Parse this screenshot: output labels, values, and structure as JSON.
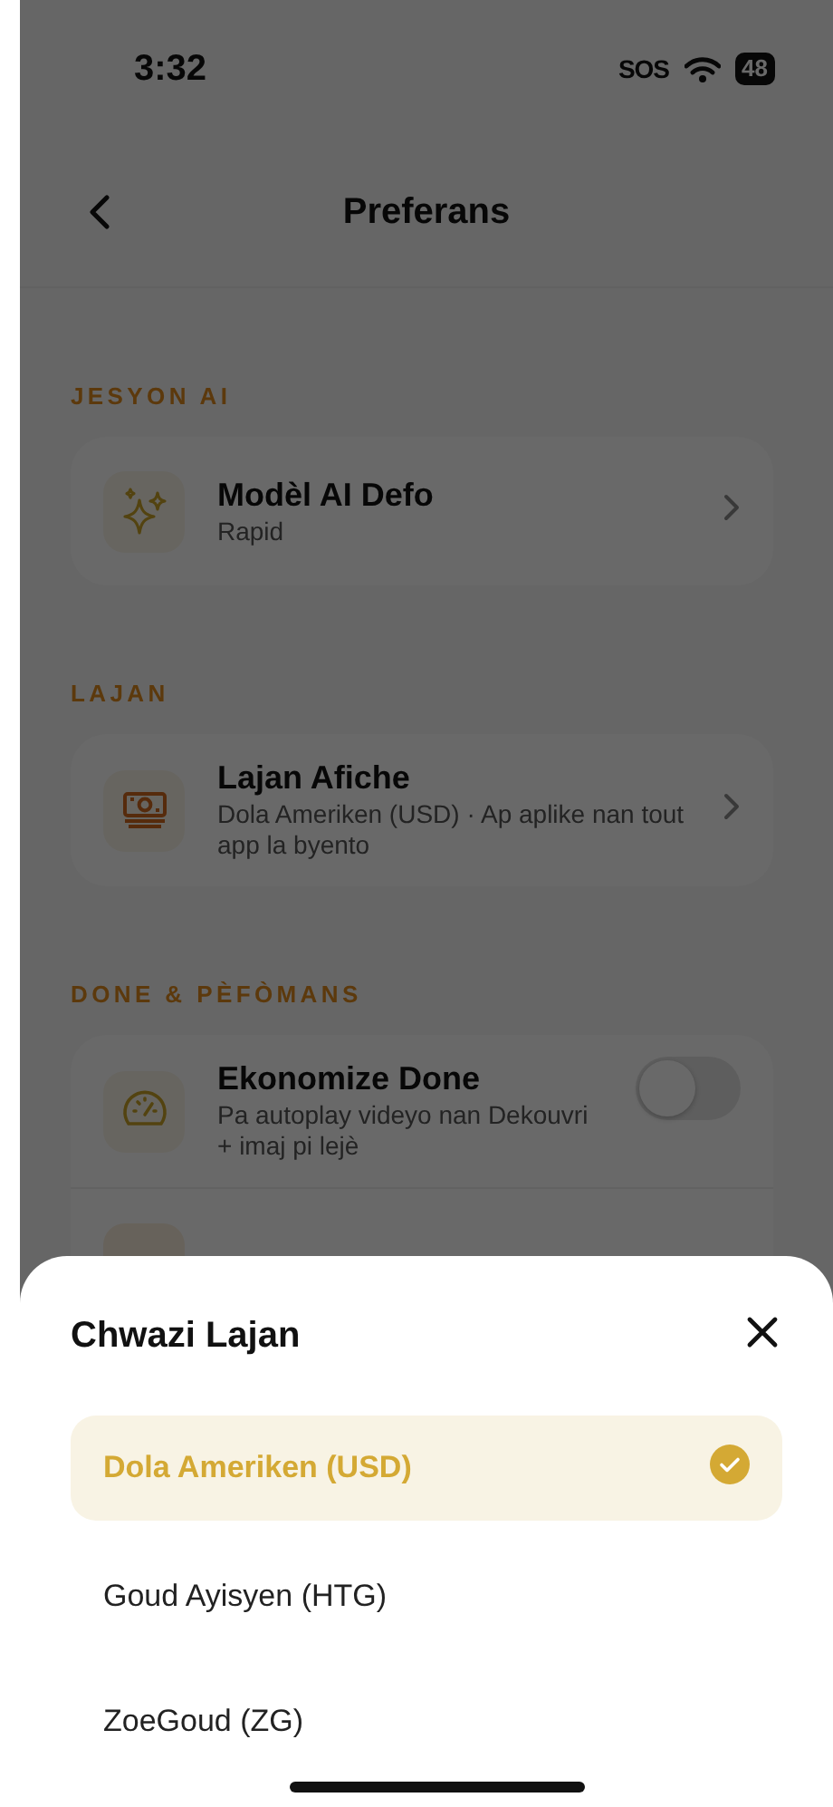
{
  "status_bar": {
    "time": "3:32",
    "sos": "SOS",
    "battery": "48"
  },
  "header": {
    "title": "Preferans"
  },
  "sections": [
    {
      "heading": "JESYON AI",
      "rows": [
        {
          "kind": "link",
          "title": "Modèl AI Defo",
          "subtitle": "Rapid"
        }
      ]
    },
    {
      "heading": "LAJAN",
      "rows": [
        {
          "kind": "link",
          "title": "Lajan Afiche",
          "subtitle": "Dola Ameriken (USD) · Ap aplike nan tout app la byento"
        }
      ]
    },
    {
      "heading": "DONE & PÈFÒMANS",
      "rows": [
        {
          "kind": "toggle",
          "title": "Ekonomize Done",
          "subtitle": "Pa autoplay videyo nan Dekouvri + imaj pi lejè",
          "on": false
        }
      ]
    }
  ],
  "sheet": {
    "title": "Chwazi Lajan",
    "options": [
      {
        "label": "Dola Ameriken (USD)",
        "selected": true
      },
      {
        "label": "Goud Ayisyen (HTG)",
        "selected": false
      },
      {
        "label": "ZoeGoud (ZG)",
        "selected": false
      }
    ]
  }
}
